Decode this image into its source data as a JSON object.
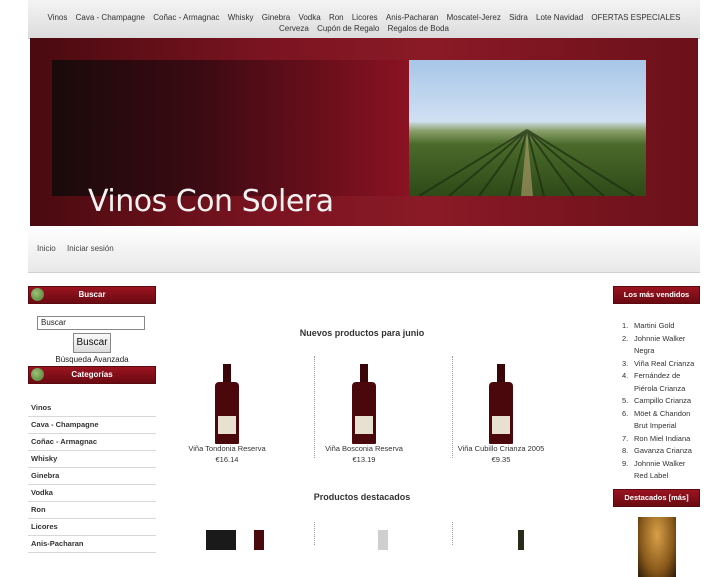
{
  "top_nav": {
    "row1": [
      "Vinos",
      "Cava - Champagne",
      "Coñac - Armagnac",
      "Whisky",
      "Ginebra",
      "Vodka",
      "Ron",
      "Licores",
      "Anis-Pacharan",
      "Moscatel-Jerez",
      "Sidra",
      "Lote Navidad",
      "OFERTAS ESPECIALES"
    ],
    "row2": [
      "Cerveza",
      "Cupón de Regalo",
      "Regalos de Boda"
    ]
  },
  "banner": {
    "title": "Vinos Con Solera"
  },
  "sub_nav": {
    "home": "Inicio",
    "login": "Iniciar sesión"
  },
  "search_box": {
    "header": "Buscar",
    "input_value": "Buscar",
    "button": "Buscar",
    "advanced": "Búsqueda Avanzada"
  },
  "categories": {
    "header": "Categorías",
    "items": [
      "Vinos",
      "Cava - Champagne",
      "Coñac - Armagnac",
      "Whisky",
      "Ginebra",
      "Vodka",
      "Ron",
      "Licores",
      "Anis-Pacharan"
    ]
  },
  "new_products": {
    "title": "Nuevos productos para junio",
    "items": [
      {
        "name": "Viña Tondonia Reserva",
        "price": "€16.14"
      },
      {
        "name": "Viña Bosconia Reserva",
        "price": "€13.19"
      },
      {
        "name": "Viña Cubillo Crianza 2005",
        "price": "€9.35"
      }
    ]
  },
  "featured": {
    "title": "Productos destacados"
  },
  "best_sellers": {
    "header": "Los más vendidos",
    "items": [
      "Martini Gold",
      "Johnnie Walker Negra",
      "Viña Real Crianza",
      "Fernández de Piérola Crianza",
      "Campillo Crianza",
      "Möet & Chandon Brut Imperial",
      "Ron Miel Indiana",
      "Gavanza Crianza",
      "Johnnie Walker Red Label"
    ]
  },
  "featured_side": {
    "header": "Destacados  [más]"
  },
  "colors": {
    "accent": "#8a1a26",
    "header_dark": "#6a0a12"
  }
}
